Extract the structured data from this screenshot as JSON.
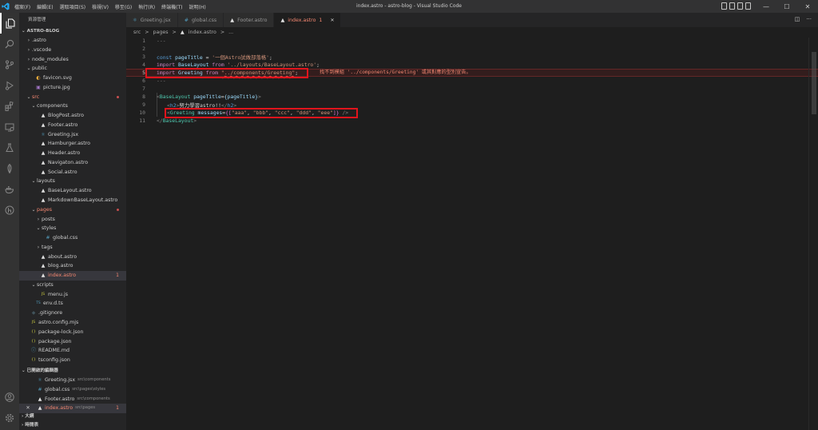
{
  "titlebar": {
    "menus": [
      "檔案(F)",
      "編輯(E)",
      "選取項目(S)",
      "檢視(V)",
      "移至(G)",
      "執行(R)",
      "終端機(T)",
      "說明(H)"
    ],
    "window_title": "index.astro - astro-blog - Visual Studio Code",
    "controls": {
      "minimize": "—",
      "maximize": "☐",
      "close": "✕"
    }
  },
  "activity_bar": {
    "items": [
      "explorer-icon",
      "search-icon",
      "source-control-icon",
      "run-debug-icon",
      "extensions-icon",
      "remote-explorer-icon",
      "testing-icon",
      "mongodb-icon",
      "docker-icon",
      "gitlens-icon"
    ],
    "bottom": [
      "account-icon",
      "settings-icon"
    ]
  },
  "explorer": {
    "header": "資源管理",
    "project": "ASTRO-BLOG",
    "tree": [
      {
        "label": ".astro",
        "type": "folder",
        "depth": 1,
        "open": false
      },
      {
        "label": ".vscode",
        "type": "folder",
        "depth": 1,
        "open": false
      },
      {
        "label": "node_modules",
        "type": "folder",
        "depth": 1,
        "open": false
      },
      {
        "label": "public",
        "type": "folder",
        "depth": 1,
        "open": true
      },
      {
        "label": "favicon.svg",
        "type": "svg",
        "depth": 2
      },
      {
        "label": "picture.jpg",
        "type": "jpg",
        "depth": 2
      },
      {
        "label": "src",
        "type": "folder",
        "depth": 1,
        "open": true,
        "error": true
      },
      {
        "label": "components",
        "type": "folder",
        "depth": 2,
        "open": true
      },
      {
        "label": "BlogPost.astro",
        "type": "astro",
        "depth": 3
      },
      {
        "label": "Footer.astro",
        "type": "astro",
        "depth": 3
      },
      {
        "label": "Greeting.jsx",
        "type": "jsx",
        "depth": 3
      },
      {
        "label": "Hamburger.astro",
        "type": "astro",
        "depth": 3
      },
      {
        "label": "Header.astro",
        "type": "astro",
        "depth": 3
      },
      {
        "label": "Navigaton.astro",
        "type": "astro",
        "depth": 3
      },
      {
        "label": "Social.astro",
        "type": "astro",
        "depth": 3
      },
      {
        "label": "layouts",
        "type": "folder",
        "depth": 2,
        "open": true
      },
      {
        "label": "BaseLayout.astro",
        "type": "astro",
        "depth": 3
      },
      {
        "label": "MarkdownBaseLayout.astro",
        "type": "astro",
        "depth": 3
      },
      {
        "label": "pages",
        "type": "folder",
        "depth": 2,
        "open": true,
        "error": true
      },
      {
        "label": "posts",
        "type": "folder",
        "depth": 3,
        "open": false
      },
      {
        "label": "styles",
        "type": "folder",
        "depth": 3,
        "open": true
      },
      {
        "label": "global.css",
        "type": "css",
        "depth": 4
      },
      {
        "label": "tags",
        "type": "folder",
        "depth": 3,
        "open": false
      },
      {
        "label": "about.astro",
        "type": "astro",
        "depth": 3
      },
      {
        "label": "blog.astro",
        "type": "astro",
        "depth": 3
      },
      {
        "label": "index.astro",
        "type": "astro",
        "depth": 3,
        "selected": true,
        "error": true,
        "badge": "1"
      },
      {
        "label": "scripts",
        "type": "folder",
        "depth": 2,
        "open": true
      },
      {
        "label": "menu.js",
        "type": "js",
        "depth": 3
      },
      {
        "label": "env.d.ts",
        "type": "ts",
        "depth": 2
      },
      {
        "label": ".gitignore",
        "type": "git",
        "depth": 1
      },
      {
        "label": "astro.config.mjs",
        "type": "js",
        "depth": 1
      },
      {
        "label": "package-lock.json",
        "type": "json",
        "depth": 1
      },
      {
        "label": "package.json",
        "type": "json",
        "depth": 1
      },
      {
        "label": "README.md",
        "type": "md",
        "depth": 1
      },
      {
        "label": "tsconfig.json",
        "type": "json",
        "depth": 1
      }
    ],
    "open_editors_title": "已開啟的編輯器",
    "open_editors": [
      {
        "label": "Greeting.jsx",
        "path": "src\\components",
        "type": "jsx"
      },
      {
        "label": "global.css",
        "path": "src\\pages\\styles",
        "type": "css"
      },
      {
        "label": "Footer.astro",
        "path": "src\\components",
        "type": "astro"
      },
      {
        "label": "index.astro",
        "path": "src\\pages",
        "type": "astro",
        "active": true,
        "close": "✕",
        "badge": "1"
      }
    ],
    "outline": "大綱",
    "timeline": "時間表"
  },
  "tabs": [
    {
      "label": "Greeting.jsx",
      "type": "jsx"
    },
    {
      "label": "global.css",
      "type": "css"
    },
    {
      "label": "Footer.astro",
      "type": "astro"
    },
    {
      "label": "index.astro",
      "type": "astro",
      "active": true,
      "badge": "1"
    }
  ],
  "tab_close": "✕",
  "breadcrumb": [
    "src",
    ">",
    "pages",
    ">",
    "index.astro",
    ">",
    "..."
  ],
  "editor": {
    "line_numbers": [
      "1",
      "2",
      "3",
      "4",
      "5",
      "6",
      "7",
      "8",
      "9",
      "10",
      "11"
    ],
    "code": {
      "l1": "---",
      "l3_kw": "const",
      "l3_var": "pageTitle",
      "l3_eq": " = ",
      "l3_str": "'一個Astro試做部落格'",
      "l3_end": ";",
      "l4_kw": "import",
      "l4_var": "BaseLayout",
      "l4_from": "from",
      "l4_str": "'../layouts/BaseLayout.astro'",
      "l4_end": ";",
      "l5_kw": "import",
      "l5_var": "Greeting",
      "l5_from": "from",
      "l5_str": "\"../components/Greeting\"",
      "l5_end": ";",
      "l6": "---",
      "l8_open": "<",
      "l8_tag": "BaseLayout",
      "l8_attr": " pageTitle",
      "l8_eq": "=",
      "l8_expr": "{pageTitle}",
      "l8_close": ">",
      "l9_open": "<",
      "l9_tag": "h2",
      "l9_gt": ">",
      "l9_text": "努力學習astro!!",
      "l9_close_tag": "</",
      "l9_tag2": "h2",
      "l9_end": ">",
      "l10_open": "<",
      "l10_tag": "Greeting",
      "l10_attr": " messages",
      "l10_eq": "=",
      "l10_expr_open": "{[",
      "l10_s1": "\"aaa\"",
      "l10_s2": "\"bbb\"",
      "l10_s3": "\"ccc\"",
      "l10_s4": "\"ddd\"",
      "l10_s5": "\"eee\"",
      "l10_comma": ", ",
      "l10_expr_close": "]}",
      "l10_end": " />",
      "l11_open": "</",
      "l11_tag": "BaseLayout",
      "l11_end": ">"
    },
    "error_message": "找不到模組 '../components/Greeting' 或其對應的型別宣告。"
  }
}
